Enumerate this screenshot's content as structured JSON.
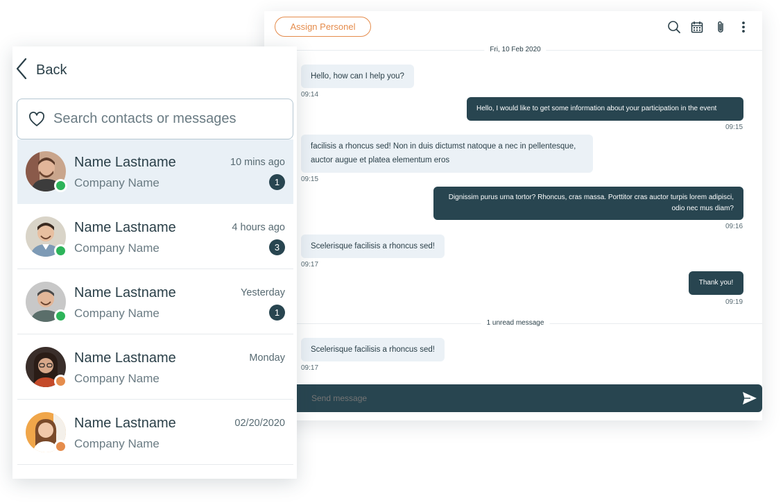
{
  "chat": {
    "assign_label": "Assign Personel",
    "date_divider": "Fri, 10 Feb 2020",
    "unread_divider": "1 unread message",
    "messages": [
      {
        "dir": "in",
        "text": "Hello, how can I help you?",
        "time": "09:14"
      },
      {
        "dir": "out",
        "text": "Hello, I would like to get some information about your participation in the event",
        "time": "09:15"
      },
      {
        "dir": "in",
        "text": "facilisis a rhoncus sed! Non in duis dictumst natoque a nec in pellentesque, auctor augue et platea elementum eros",
        "time": "09:15"
      },
      {
        "dir": "out",
        "text": "Dignissim purus urna tortor? Rhoncus, cras massa. Porttitor cras auctor turpis lorem adipisci, odio nec mus diam?",
        "time": "09:16"
      },
      {
        "dir": "in",
        "text": "Scelerisque facilisis a rhoncus sed!",
        "time": "09:17"
      },
      {
        "dir": "out",
        "text": "Thank you!",
        "time": "09:19"
      },
      {
        "dir": "in",
        "text": "Scelerisque facilisis a rhoncus sed!",
        "time": "09:17"
      }
    ],
    "composer_placeholder": "Send message"
  },
  "contacts": {
    "back_label": "Back",
    "search_placeholder": "Search contacts or messages",
    "items": [
      {
        "name": "Name Lastname",
        "company": "Company Name",
        "time": "10 mins ago",
        "unread": "1",
        "status": "online"
      },
      {
        "name": "Name Lastname",
        "company": "Company Name",
        "time": "4 hours ago",
        "unread": "3",
        "status": "online"
      },
      {
        "name": "Name Lastname",
        "company": "Company Name",
        "time": "Yesterday",
        "unread": "1",
        "status": "online"
      },
      {
        "name": "Name Lastname",
        "company": "Company Name",
        "time": "Monday",
        "unread": "",
        "status": "away"
      },
      {
        "name": "Name Lastname",
        "company": "Company Name",
        "time": "02/20/2020",
        "unread": "",
        "status": "away"
      }
    ]
  },
  "icons": {
    "toolbar": [
      "search-icon",
      "calendar-icon",
      "paperclip-icon",
      "more-vertical-icon"
    ],
    "back": "chevron-left-icon",
    "search": "heart-icon",
    "send": "send-icon"
  },
  "colors": {
    "accent_orange": "#e58c4c",
    "dark_teal": "#284550",
    "incoming_bubble": "#ebf1f6",
    "online": "#2db45a",
    "away": "#e58c4c",
    "active_row": "#e9f0f6"
  }
}
